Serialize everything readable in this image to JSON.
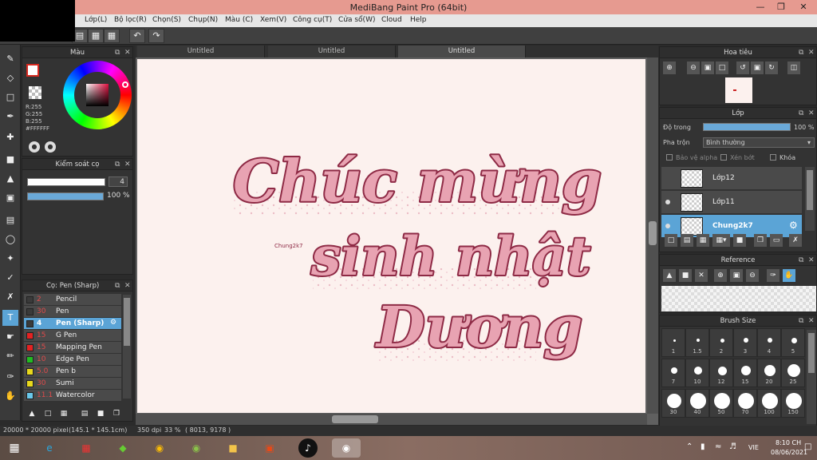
{
  "window": {
    "title": "MediBang Paint Pro (64bit)"
  },
  "menu": [
    "Lớp(L)",
    "Bộ lọc(R)",
    "Chọn(S)",
    "Chụp(N)",
    "Màu (C)",
    "Xem(V)",
    "Công cụ(T)",
    "Cửa sổ(W)",
    "Cloud",
    "Help"
  ],
  "color_panel": {
    "title": "Màu",
    "r": "R:255",
    "g": "G:255",
    "b": "B:255",
    "hex": "#FFFFFF"
  },
  "brush_control": {
    "title": "Kiểm soát cọ",
    "size": "4",
    "opacity": "100 %",
    "opacity_value": 100
  },
  "brush_list": {
    "title": "Cọ: Pen (Sharp)",
    "items": [
      {
        "size": "2",
        "name": "Pencil",
        "color": "#3a3a3a"
      },
      {
        "size": "30",
        "name": "Pen",
        "color": "#3a3a3a"
      },
      {
        "size": "4",
        "name": "Pen (Sharp)",
        "color": "#3a3a3a",
        "selected": true
      },
      {
        "size": "15",
        "name": "G Pen",
        "color": "#e52222"
      },
      {
        "size": "15",
        "name": "Mapping Pen",
        "color": "#e52222"
      },
      {
        "size": "10",
        "name": "Edge Pen",
        "color": "#22bb22"
      },
      {
        "size": "5.0",
        "name": "Pen b",
        "color": "#e8d81c"
      },
      {
        "size": "30",
        "name": "Sumi",
        "color": "#e8d81c"
      },
      {
        "size": "11.1",
        "name": "Watercolor",
        "color": "#69c7ea"
      }
    ]
  },
  "tabs": [
    "Untitled",
    "Untitled",
    "Untitled"
  ],
  "canvas": {
    "line1": "Chúc mừng",
    "line2": "sinh nhật",
    "line3": "Dương",
    "signature": "Chung2k7",
    "ink_color": "#8e2a45",
    "fill_color": "#e8a3b2"
  },
  "navigator": {
    "title": "Hoa tiêu"
  },
  "layers": {
    "title": "Lớp",
    "opacity_label": "Độ trong",
    "opacity": "100 %",
    "blend_label": "Pha trộn",
    "blend_value": "Bình thường",
    "protect_alpha": "Bảo vệ alpha",
    "clipping": "Xén bớt",
    "lock": "Khóa",
    "items": [
      {
        "name": "Lớp12",
        "selected": false
      },
      {
        "name": "Lớp11",
        "selected": false
      },
      {
        "name": "Chung2k7",
        "selected": true
      }
    ]
  },
  "reference": {
    "title": "Reference"
  },
  "brush_size": {
    "title": "Brush Size",
    "sizes": [
      "1",
      "1.5",
      "2",
      "3",
      "4",
      "5",
      "7",
      "10",
      "12",
      "15",
      "20",
      "25",
      "30",
      "40",
      "50",
      "70",
      "100",
      "150"
    ]
  },
  "status": {
    "dimensions": "20000 * 20000 pixel",
    "physical": "(145.1 * 145.1cm)",
    "dpi": "350 dpi",
    "zoom": "33 %",
    "cursor": "( 8013, 9178 )"
  },
  "taskbar": {
    "lang": "VIE",
    "time": "8:10 CH",
    "date": "08/06/2021"
  }
}
